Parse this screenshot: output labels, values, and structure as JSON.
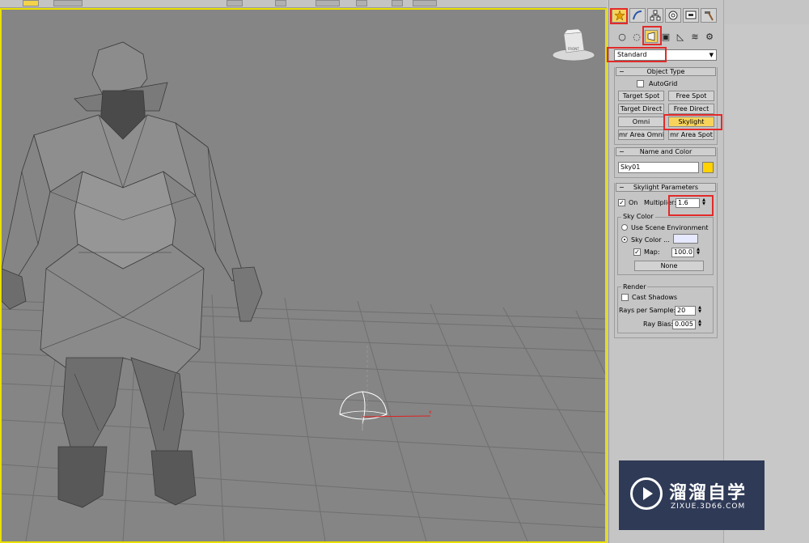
{
  "command_panel": {
    "tabs": [
      "create-tab",
      "modify-tab",
      "hierarchy-tab",
      "motion-tab",
      "display-tab",
      "utilities-tab"
    ],
    "category_icons": [
      "geometry-icon",
      "shapes-icon",
      "lights-icon",
      "cameras-icon",
      "helpers-icon",
      "space-warps-icon",
      "systems-icon"
    ],
    "light_type_dropdown": "Standard",
    "object_type": {
      "header": "Object Type",
      "autogrid_label": "AutoGrid",
      "buttons": [
        "Target Spot",
        "Free Spot",
        "Target Direct",
        "Free Direct",
        "Omni",
        "Skylight",
        "mr Area Omni",
        "mr Area Spot"
      ]
    },
    "name_and_color": {
      "header": "Name and Color",
      "name_value": "Sky01",
      "color": "#ffd200"
    },
    "skylight_parameters": {
      "header": "Skylight Parameters",
      "on_label": "On",
      "multiplier_label": "Multiplier:",
      "multiplier_value": "1.6",
      "sky_color_group": "Sky Color",
      "use_scene_env_label": "Use Scene Environment",
      "sky_color_label": "Sky Color ...",
      "sky_color_swatch": "#e6e9ff",
      "map_label": "Map:",
      "map_value": "100.0",
      "map_button": "None",
      "render_group": "Render",
      "cast_shadows_label": "Cast Shadows",
      "rays_label": "Rays per Sample:",
      "rays_value": "20",
      "ray_bias_label": "Ray Bias:",
      "ray_bias_value": "0.005"
    }
  },
  "viewport": {
    "viewcube_label": "FRONT",
    "border_color": "#e9e000"
  },
  "watermark": {
    "title": "溜溜自学",
    "url": "ZIXUE.3D66.COM"
  }
}
